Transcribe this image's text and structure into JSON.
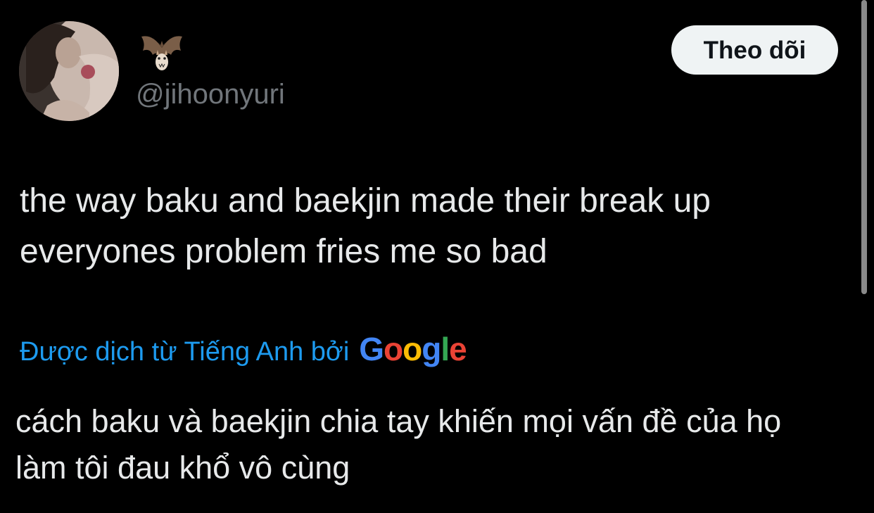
{
  "author": {
    "display_name_icon": "bat-icon",
    "handle": "@jihoonyuri",
    "avatar": "profile-photo"
  },
  "follow_button_label": "Theo dõi",
  "tweet": {
    "lines": [
      "the way baku and baekjin made their break up",
      "everyones problem fries me so bad"
    ]
  },
  "translation": {
    "label": "Được dịch từ Tiếng Anh bởi",
    "provider_letters": [
      "G",
      "o",
      "o",
      "g",
      "l",
      "e"
    ],
    "lines": [
      "cách baku và baekjin chia tay khiến mọi vấn đề của họ",
      "làm tôi đau khổ vô cùng"
    ]
  },
  "colors": {
    "background": "#000000",
    "text": "#e7e9ea",
    "secondary": "#71767b",
    "link": "#1d9bf0",
    "button_bg": "#eff3f4",
    "google_blue": "#4285f4",
    "google_red": "#ea4335",
    "google_yellow": "#fbbc05",
    "google_green": "#34a853"
  }
}
